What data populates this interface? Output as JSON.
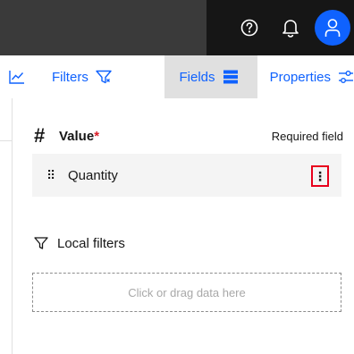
{
  "header": {
    "icons": [
      "help-icon",
      "notification-icon",
      "user-icon"
    ],
    "accent_color": "#0f62fe"
  },
  "toolbar": {
    "tabs": [
      {
        "label": "",
        "icon": "line-chart-icon"
      },
      {
        "label": "Filters",
        "icon": "filter-icon"
      },
      {
        "label": "Fields",
        "icon": "data-table-icon",
        "selected": true
      },
      {
        "label": "Properties",
        "icon": "settings-adjust-icon"
      }
    ]
  },
  "value_section": {
    "symbol": "#",
    "title": "Value",
    "required_marker": "*",
    "required_text": "Required field",
    "field": {
      "grip": "⠿",
      "name": "Quantity",
      "overflow": "⋮"
    }
  },
  "local_filters": {
    "label": "Local filters",
    "dropzone_hint": "Click or drag data here"
  }
}
